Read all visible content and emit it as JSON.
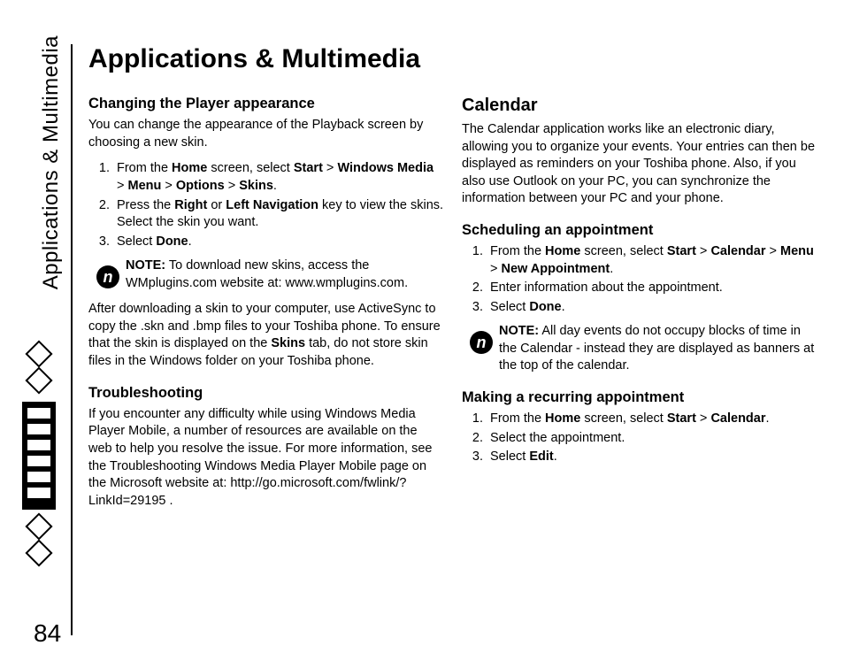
{
  "sidebar_title": "Applications & Multimedia",
  "page_number": "84",
  "title": "Applications & Multimedia",
  "left": {
    "h_changing": "Changing the Player appearance",
    "p_changing": "You can change the appearance of the Playback screen by choosing a new skin.",
    "steps_changing": {
      "s1_a": "From the ",
      "s1_b": "Home",
      "s1_c": " screen, select ",
      "s1_d": "Start",
      "s1_e": " > ",
      "s1_f": "Windows Media",
      "s1_g": " > ",
      "s1_h": "Menu",
      "s1_i": " > ",
      "s1_j": "Options",
      "s1_k": " > ",
      "s1_l": "Skins",
      "s1_m": ".",
      "s2_a": "Press the ",
      "s2_b": "Right",
      "s2_c": " or ",
      "s2_d": "Left Navigation",
      "s2_e": " key to view the skins. Select the skin you want.",
      "s3_a": "Select ",
      "s3_b": "Done",
      "s3_c": "."
    },
    "note1_label": "NOTE:",
    "note1_text": " To download new skins, access the WMplugins.com website at: www.wmplugins.com.",
    "p_after_a": "After downloading a skin to your computer, use ActiveSync to copy the .skn and .bmp files to your Toshiba phone. To ensure that the skin is displayed on the ",
    "p_after_b": "Skins",
    "p_after_c": " tab, do not store skin files in the Windows folder on your Toshiba phone.",
    "h_trouble": "Troubleshooting",
    "p_trouble": "If you encounter any difficulty while using Windows Media Player Mobile, a number of resources are available on the web to help you resolve the issue. For more information, see the Troubleshooting Windows Media Player Mobile page on the Microsoft website at: http://go.microsoft.com/fwlink/?LinkId=29195 ."
  },
  "right": {
    "h_calendar": "Calendar",
    "p_calendar": "The Calendar application works like an electronic diary, allowing you to organize your events. Your entries can then be displayed as reminders on your Toshiba phone. Also, if you also use Outlook on your PC, you can synchronize the information between your PC and your phone.",
    "h_sched": "Scheduling an appointment",
    "steps_sched": {
      "s1_a": "From the ",
      "s1_b": "Home",
      "s1_c": " screen, select ",
      "s1_d": "Start",
      "s1_e": " > ",
      "s1_f": "Calendar",
      "s1_g": " > ",
      "s1_h": "Menu",
      "s1_i": " > ",
      "s1_j": "New Appointment",
      "s1_k": ".",
      "s2": "Enter information about the appointment.",
      "s3_a": "Select ",
      "s3_b": "Done",
      "s3_c": "."
    },
    "note2_label": "NOTE:",
    "note2_text": " All day events do not occupy blocks of time in the Calendar - instead they are displayed as banners at the top of the calendar.",
    "h_recur": "Making a recurring appointment",
    "steps_recur": {
      "s1_a": "From the ",
      "s1_b": "Home",
      "s1_c": " screen, select ",
      "s1_d": "Start",
      "s1_e": " > ",
      "s1_f": "Calendar",
      "s1_g": ".",
      "s2": "Select the appointment.",
      "s3_a": "Select ",
      "s3_b": "Edit",
      "s3_c": "."
    }
  }
}
